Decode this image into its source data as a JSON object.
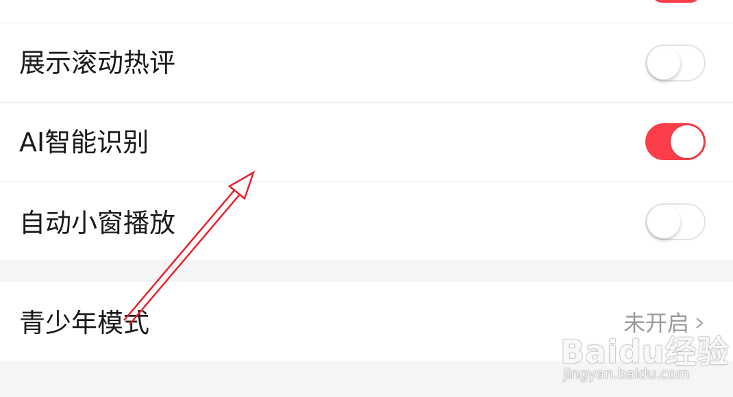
{
  "settings": {
    "items": [
      {
        "label": "展示滚动热评",
        "toggle": "off"
      },
      {
        "label": "AI智能识别",
        "toggle": "on"
      },
      {
        "label": "自动小窗播放",
        "toggle": "off"
      }
    ],
    "youth_mode": {
      "label": "青少年模式",
      "status": "未开启"
    }
  },
  "colors": {
    "toggle_on": "#fb3e4a",
    "annotation_arrow": "#e8202a"
  },
  "watermark": {
    "brand": "Baidu经验",
    "site": "jingyan.baidu.com"
  }
}
